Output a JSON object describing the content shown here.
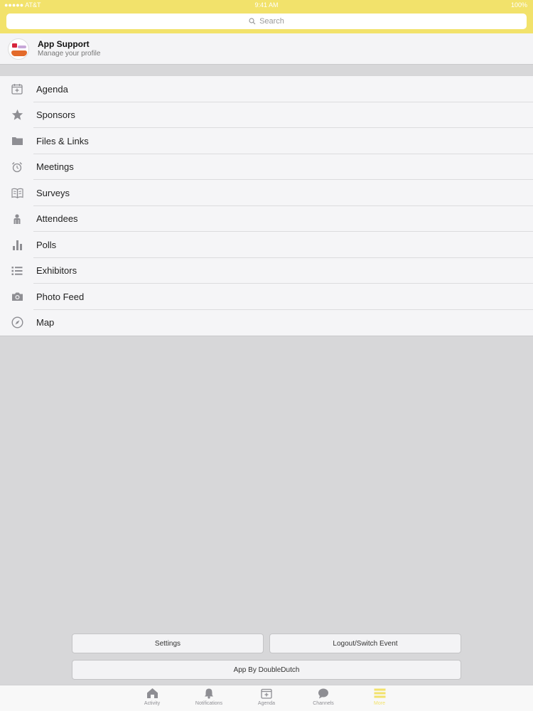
{
  "status_bar": {
    "carrier": "●●●●● AT&T",
    "time": "9:41 AM",
    "battery": "100%"
  },
  "search": {
    "placeholder": "Search"
  },
  "profile": {
    "name": "App Support",
    "subtitle": "Manage your profile"
  },
  "menu": {
    "items": [
      {
        "label": "Agenda",
        "icon": "calendar-icon"
      },
      {
        "label": "Sponsors",
        "icon": "star-icon"
      },
      {
        "label": "Files & Links",
        "icon": "folder-icon"
      },
      {
        "label": "Meetings",
        "icon": "alarm-clock-icon"
      },
      {
        "label": "Surveys",
        "icon": "book-icon"
      },
      {
        "label": "Attendees",
        "icon": "people-icon"
      },
      {
        "label": "Polls",
        "icon": "bar-chart-icon"
      },
      {
        "label": "Exhibitors",
        "icon": "list-icon"
      },
      {
        "label": "Photo Feed",
        "icon": "camera-icon"
      },
      {
        "label": "Map",
        "icon": "compass-icon"
      }
    ]
  },
  "buttons": {
    "settings": "Settings",
    "logout": "Logout/Switch Event",
    "app_by": "App By DoubleDutch"
  },
  "tabbar": {
    "tabs": [
      {
        "label": "Activity",
        "icon": "home-icon"
      },
      {
        "label": "Notifications",
        "icon": "bell-icon"
      },
      {
        "label": "Agenda",
        "icon": "calendar-icon"
      },
      {
        "label": "Channels",
        "icon": "chat-bubble-icon"
      },
      {
        "label": "More",
        "icon": "menu-icon"
      }
    ],
    "active": "More"
  },
  "colors": {
    "accent": "#f2e26b",
    "background": "#d7d7d9",
    "icon_gray": "#8e8e93"
  }
}
